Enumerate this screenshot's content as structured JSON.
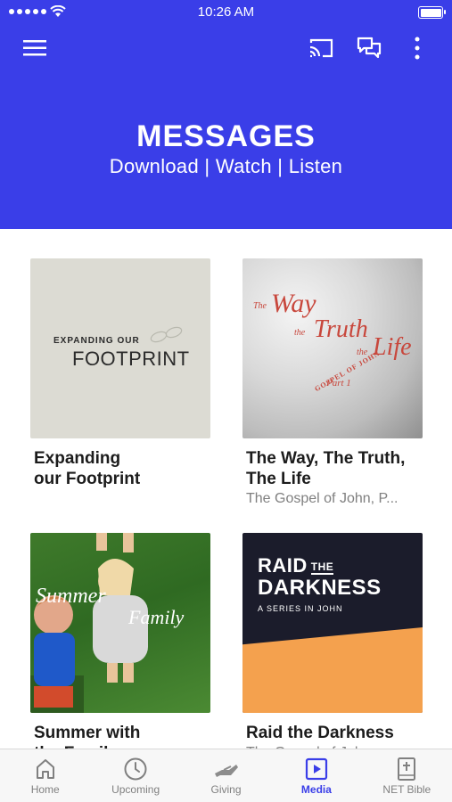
{
  "status_bar": {
    "time": "10:26 AM"
  },
  "header": {
    "title": "MESSAGES",
    "subtitle": "Download | Watch | Listen"
  },
  "icons": {
    "menu": "hamburger-menu-icon",
    "cast": "cast-icon",
    "chat": "chat-icon",
    "more": "more-vertical-icon"
  },
  "cards": [
    {
      "title_line1": "Expanding",
      "title_line2": "our Footprint",
      "subtitle": "",
      "art": {
        "line1": "EXPANDING OUR",
        "line2": "FOOTPRINT"
      }
    },
    {
      "title_line1": "The Way, The Truth,",
      "title_line2": "The Life",
      "subtitle": "The Gospel of John, P...",
      "art": {
        "the1": "The",
        "way": "Way",
        "the2": "the",
        "truth": "Truth",
        "the3": "the",
        "life": "Life",
        "gospel": "GOSPEL OF JOHN",
        "part": "Part 1"
      }
    },
    {
      "title_line1": "Summer with",
      "title_line2": "the Family",
      "subtitle": "",
      "art": {
        "line1": "Summer",
        "line2": "Family"
      }
    },
    {
      "title_line1": "Raid the Darkness",
      "title_line2": "",
      "subtitle": "The Gospel of John",
      "art": {
        "raid": "RAID",
        "the": "THE",
        "darkness": "DARKNESS",
        "series": "A SERIES IN JOHN"
      }
    }
  ],
  "tabs": [
    {
      "label": "Home",
      "icon": "home-icon",
      "active": false
    },
    {
      "label": "Upcoming",
      "icon": "clock-icon",
      "active": false
    },
    {
      "label": "Giving",
      "icon": "giving-hand-icon",
      "active": false
    },
    {
      "label": "Media",
      "icon": "play-icon",
      "active": true
    },
    {
      "label": "NET Bible",
      "icon": "bible-icon",
      "active": false
    }
  ],
  "colors": {
    "brand": "#3a3ee8",
    "tab_inactive": "#808080",
    "tab_active": "#3a3ee8"
  }
}
